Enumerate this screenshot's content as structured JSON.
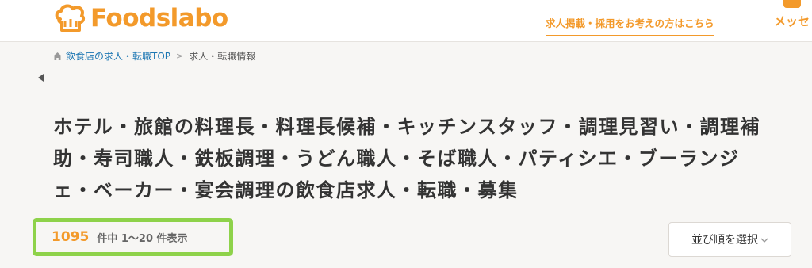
{
  "header": {
    "logo_text": "Foodslabo",
    "employer_link": "求人掲載・採用をお考えの方はこちら",
    "message_label": "メッセ"
  },
  "breadcrumb": {
    "home": "飲食店の求人・転職TOP",
    "separator": ">",
    "current": "求人・転職情報"
  },
  "page": {
    "title": "ホテル・旅館の料理長・料理長候補・キッチンスタッフ・調理見習い・調理補助・寿司職人・鉄板調理・うどん職人・そば職人・パティシエ・ブーランジェ・ベーカー・宴会調理の飲食店求人・転職・募集"
  },
  "results": {
    "total": "1095",
    "range_text": "件中 1〜20 件表示"
  },
  "sort": {
    "label": "並び順を選択"
  },
  "colors": {
    "brand": "#f39a2b",
    "highlight": "#8ed24a",
    "link": "#1d77b3"
  }
}
